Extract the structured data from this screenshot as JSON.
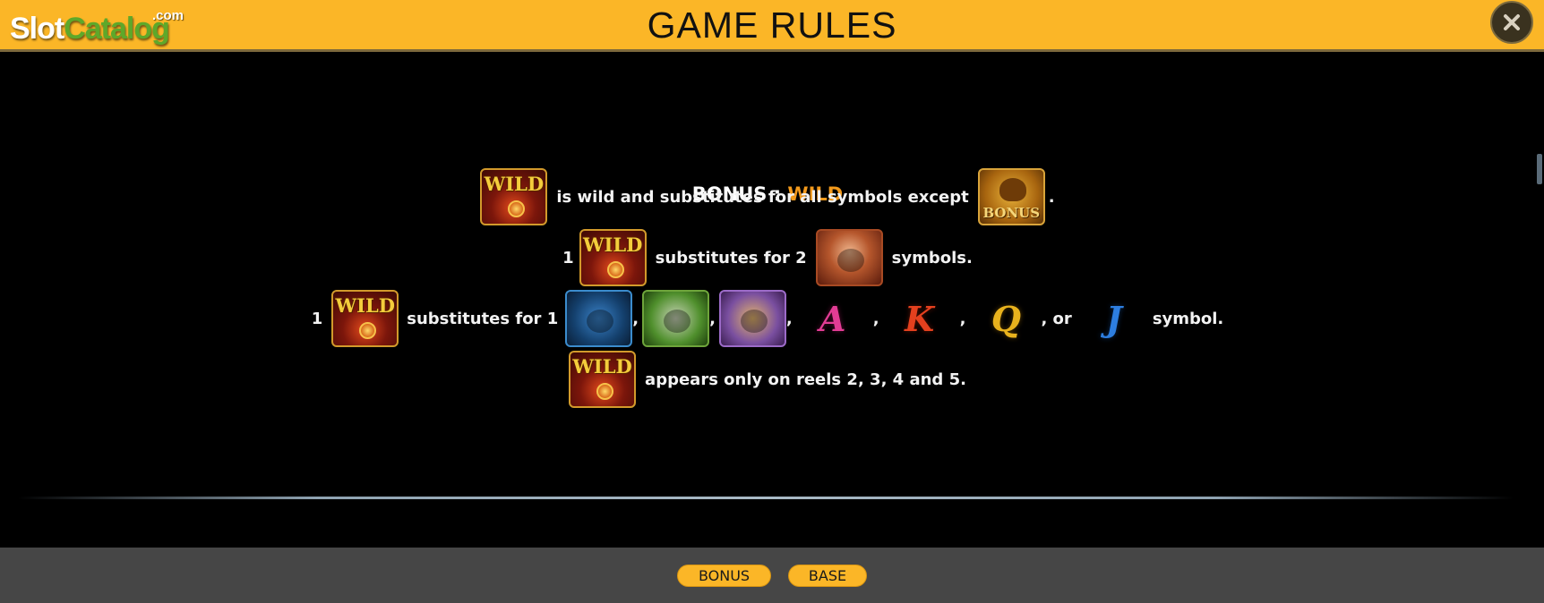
{
  "header": {
    "logo": {
      "part1": "Slot",
      "part2": "Catalog",
      "suffix": ".com"
    },
    "title": "GAME RULES",
    "close_icon": "close-icon"
  },
  "section": {
    "title_prefix": "BONUS : ",
    "title_highlight": "WILD"
  },
  "rules": [
    {
      "text_main": "is wild and substitutes for all symbols except",
      "text_end": "."
    },
    {
      "count": "1",
      "text_main": "substitutes for 2",
      "text_end": "symbols."
    },
    {
      "count": "1",
      "text_main": "substitutes for 1",
      "separator": ",",
      "or_text": ", or",
      "text_end": "symbol."
    },
    {
      "text_main": "appears only on reels 2, 3, 4 and 5."
    }
  ],
  "symbols": {
    "wild": "WILD",
    "bonus": "BONUS",
    "cards": [
      "A",
      "K",
      "Q",
      "J"
    ]
  },
  "footer": {
    "tabs": [
      "BONUS",
      "BASE"
    ]
  },
  "colors": {
    "header_bg": "#fbb627",
    "accent_orange": "#f39a1c",
    "footer_bg": "#464646"
  }
}
